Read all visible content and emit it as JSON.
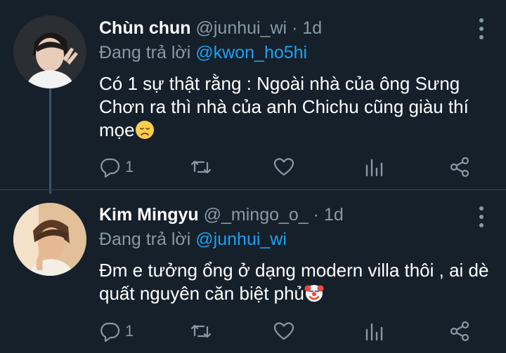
{
  "tweets": [
    {
      "name": "Chùn chun",
      "handle": "@junhui_wi",
      "separator": "·",
      "time": "1d",
      "reply_prefix": "Đang trả lời",
      "reply_to": "@kwon_ho5hi",
      "text": "Có 1 sự thật rằng : Ngoài nhà của ông Sưng Chơn ra thì nhà của anh Chichu cũng giàu thí mọe",
      "emoji": "disappointed-face",
      "reply_count": "1"
    },
    {
      "name": "Kim Mingyu",
      "handle": "@_mingo_o_",
      "separator": "·",
      "time": "1d",
      "reply_prefix": "Đang trả lời",
      "reply_to": "@junhui_wi",
      "text": "Đm e tưởng ổng ở dạng modern villa thôi , ai dè quất nguyên căn biệt phủ",
      "emoji": "clown-face",
      "reply_count": "1"
    }
  ],
  "colors": {
    "background": "#15202b",
    "secondary_text": "#8899a6",
    "link": "#1da1f2",
    "divider": "#38444d"
  }
}
